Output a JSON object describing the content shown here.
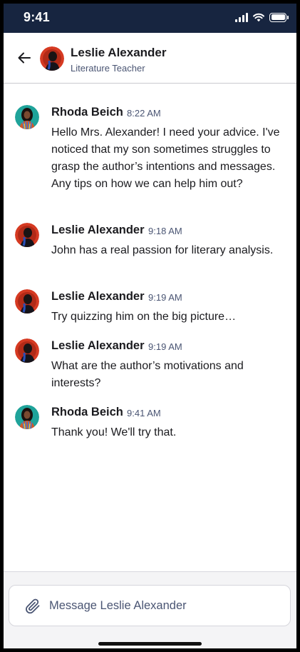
{
  "status_bar": {
    "time": "9:41",
    "icons": [
      "signal-icon",
      "wifi-icon",
      "battery-icon"
    ],
    "background": "#172540"
  },
  "header": {
    "contact_name": "Leslie Alexander",
    "contact_role": "Literature Teacher",
    "back_icon": "arrow-left-icon"
  },
  "messages": [
    {
      "sender": "Rhoda Beich",
      "time": "8:22 AM",
      "avatar": "rhoda",
      "text": "Hello Mrs. Alexander! I need your advice. I've noticed that my son sometimes struggles to grasp the author’s intentions and messages. Any tips on how we can help him out?"
    },
    {
      "sender": "Leslie Alexander",
      "time": "9:18 AM",
      "avatar": "leslie",
      "text": "John has a real passion for literary analysis."
    },
    {
      "sender": "Leslie Alexander",
      "time": "9:19 AM",
      "avatar": "leslie",
      "text": "Try quizzing him on the big picture…"
    },
    {
      "sender": "Leslie Alexander",
      "time": "9:19 AM",
      "avatar": "leslie",
      "text": "What are the author’s motivations and interests?"
    },
    {
      "sender": "Rhoda Beich",
      "time": "9:41 AM",
      "avatar": "rhoda",
      "text": "Thank you! We'll try that."
    }
  ],
  "composer": {
    "placeholder": "Message Leslie Alexander",
    "attach_icon": "paperclip-icon"
  }
}
